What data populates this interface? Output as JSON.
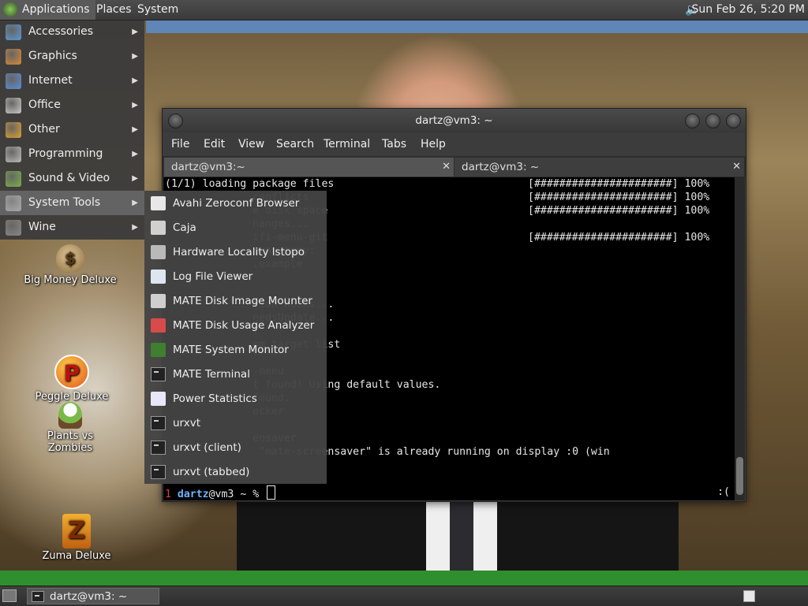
{
  "top_panel": {
    "menus": [
      "Applications",
      "Places",
      "System"
    ],
    "clock": "Sun Feb 26,  5:20 PM",
    "volume_icon": "speaker-icon"
  },
  "apps_menu": {
    "items": [
      {
        "label": "Accessories",
        "icon": "accessories-icon",
        "color": "#5a9ad6"
      },
      {
        "label": "Graphics",
        "icon": "graphics-icon",
        "color": "#d68a3a"
      },
      {
        "label": "Internet",
        "icon": "internet-icon",
        "color": "#5b8fd8"
      },
      {
        "label": "Office",
        "icon": "office-icon",
        "color": "#c9c9c9"
      },
      {
        "label": "Other",
        "icon": "other-icon",
        "color": "#e0a030"
      },
      {
        "label": "Programming",
        "icon": "programming-icon",
        "color": "#bbbbbb"
      },
      {
        "label": "Sound & Video",
        "icon": "sound-video-icon",
        "color": "#7ab04a"
      },
      {
        "label": "System Tools",
        "icon": "system-tools-icon",
        "color": "#aaaaaa"
      },
      {
        "label": "Wine",
        "icon": "wine-icon",
        "color": "#888888"
      }
    ],
    "active_index": 7
  },
  "system_tools_menu": {
    "items": [
      {
        "label": "Avahi Zeroconf Browser",
        "icon": "avahi-icon"
      },
      {
        "label": "Caja",
        "icon": "caja-icon"
      },
      {
        "label": "Hardware Locality lstopo",
        "icon": "hardware-icon"
      },
      {
        "label": "Log File Viewer",
        "icon": "log-viewer-icon"
      },
      {
        "label": "MATE Disk Image Mounter",
        "icon": "disk-mounter-icon"
      },
      {
        "label": "MATE Disk Usage Analyzer",
        "icon": "disk-usage-icon"
      },
      {
        "label": "MATE System Monitor",
        "icon": "system-monitor-icon"
      },
      {
        "label": "MATE Terminal",
        "icon": "terminal-icon"
      },
      {
        "label": "Power Statistics",
        "icon": "power-statistics-icon"
      },
      {
        "label": "urxvt",
        "icon": "terminal-icon"
      },
      {
        "label": "urxvt (client)",
        "icon": "terminal-icon"
      },
      {
        "label": "urxvt (tabbed)",
        "icon": "terminal-icon"
      }
    ]
  },
  "desktop_icons": [
    {
      "label": "Big Money Deluxe",
      "icon": "money-bag-icon"
    },
    {
      "label": "Peggle Deluxe",
      "icon": "peggle-icon"
    },
    {
      "label": "Plants vs Zombies",
      "icon": "plants-zombies-icon"
    },
    {
      "label": "Zuma Deluxe",
      "icon": "zuma-icon"
    }
  ],
  "terminal": {
    "title": "dartz@vm3: ~",
    "menubar": [
      "File",
      "Edit",
      "View",
      "Search",
      "Terminal",
      "Tabs",
      "Help"
    ],
    "tabs": [
      {
        "label": "dartz@vm3:~",
        "close": "✕"
      },
      {
        "label": "dartz@vm3: ~",
        "close": "✕"
      }
    ],
    "lines": [
      {
        "text": "(1/1) loading package files",
        "progress": "[######################] 100%"
      },
      {
        "text": "              conflicts",
        "progress": "[######################] 100%"
      },
      {
        "text": "              e disk space",
        "progress": "[######################] 100%"
      },
      {
        "text": "              hanges...",
        "progress": ""
      },
      {
        "text": "              ifi-menu-git",
        "progress": "[######################] 100%"
      },
      {
        "text": "              menu copy:",
        "progress": ""
      },
      {
        "text": "              .example",
        "progress": ""
      },
      {
        "text": "",
        "progress": ""
      },
      {
        "text": "",
        "progress": ""
      },
      {
        "text": "              tion hooks...",
        "progress": ""
      },
      {
        "text": "              eedsUpdate...",
        "progress": ""
      },
      {
        "text": "              .",
        "progress": ""
      },
      {
        "text": "              om target list",
        "progress": ""
      },
      {
        "text": "",
        "progress": ""
      },
      {
        "text": "              -menu",
        "progress": ""
      },
      {
        "text": "              t found! Using default values.",
        "progress": ""
      },
      {
        "text": "              found.",
        "progress": ""
      },
      {
        "text": "              ocker",
        "progress": ""
      },
      {
        "text": "",
        "progress": ""
      },
      {
        "text": "              ensaver",
        "progress": ""
      },
      {
        "text": "               \"mate-screensaver\" is already running on display :0 (win",
        "progress": ""
      }
    ],
    "prompt": {
      "num": "1",
      "user": "dartz",
      "host": "@vm3",
      "rest": " ~ %",
      "right": ":("
    }
  },
  "bottom_panel": {
    "task_label": "dartz@vm3: ~",
    "show_desktop_icon": "show-desktop-icon",
    "workspace_icon": "workspace-switcher-icon"
  }
}
